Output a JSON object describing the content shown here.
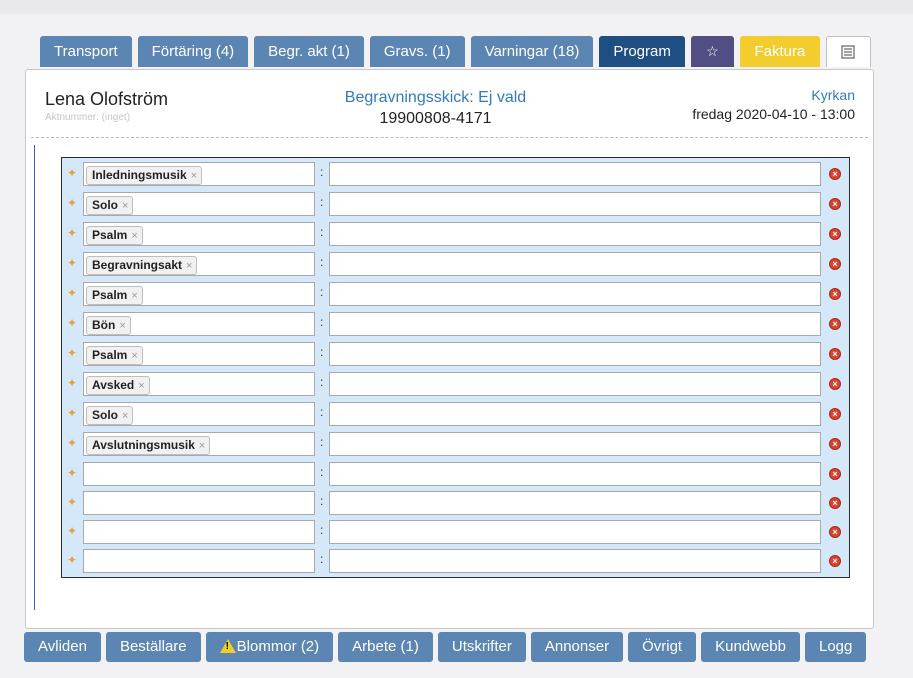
{
  "tabs": [
    {
      "label": "Transport",
      "style": "blue"
    },
    {
      "label": "Förtäring (4)",
      "style": "blue"
    },
    {
      "label": "Begr. akt (1)",
      "style": "blue"
    },
    {
      "label": "Gravs. (1)",
      "style": "blue"
    },
    {
      "label": "Varningar (18)",
      "style": "blue"
    },
    {
      "label": "Program",
      "style": "active"
    },
    {
      "label": "",
      "style": "purple",
      "icon": "star-icon"
    },
    {
      "label": "Faktura",
      "style": "yellow"
    },
    {
      "label": "",
      "style": "white",
      "icon": "list-icon"
    }
  ],
  "header": {
    "name": "Lena Olofström",
    "aktnummer": "Aktnummer: (inget)",
    "ceremony": "Begravningsskick: Ej vald",
    "personnummer": "19900808-4171",
    "location": "Kyrkan",
    "datetime": "fredag 2020-04-10 - 13:00"
  },
  "program_rows": [
    {
      "item": "Inledningsmusik",
      "text": ""
    },
    {
      "item": "Solo",
      "text": ""
    },
    {
      "item": "Psalm",
      "text": ""
    },
    {
      "item": "Begravningsakt",
      "text": ""
    },
    {
      "item": "Psalm",
      "text": ""
    },
    {
      "item": "Bön",
      "text": ""
    },
    {
      "item": "Psalm",
      "text": ""
    },
    {
      "item": "Avsked",
      "text": ""
    },
    {
      "item": "Solo",
      "text": ""
    },
    {
      "item": "Avslutningsmusik",
      "text": ""
    },
    {
      "item": "",
      "text": ""
    },
    {
      "item": "",
      "text": ""
    },
    {
      "item": "",
      "text": ""
    },
    {
      "item": "",
      "text": ""
    }
  ],
  "row_separator": ":",
  "bottom_buttons": [
    {
      "label": "Avliden"
    },
    {
      "label": "Beställare"
    },
    {
      "label": "Blommor (2)",
      "warning": true
    },
    {
      "label": "Arbete (1)"
    },
    {
      "label": "Utskrifter"
    },
    {
      "label": "Annonser"
    },
    {
      "label": "Övrigt"
    },
    {
      "label": "Kundwebb"
    },
    {
      "label": "Logg"
    }
  ],
  "colors": {
    "tab": "#5b86b4",
    "active_tab": "#1f4f82",
    "faktura": "#f3cc2e",
    "link": "#2f7bbd",
    "list_bg": "#d5e8fa"
  }
}
